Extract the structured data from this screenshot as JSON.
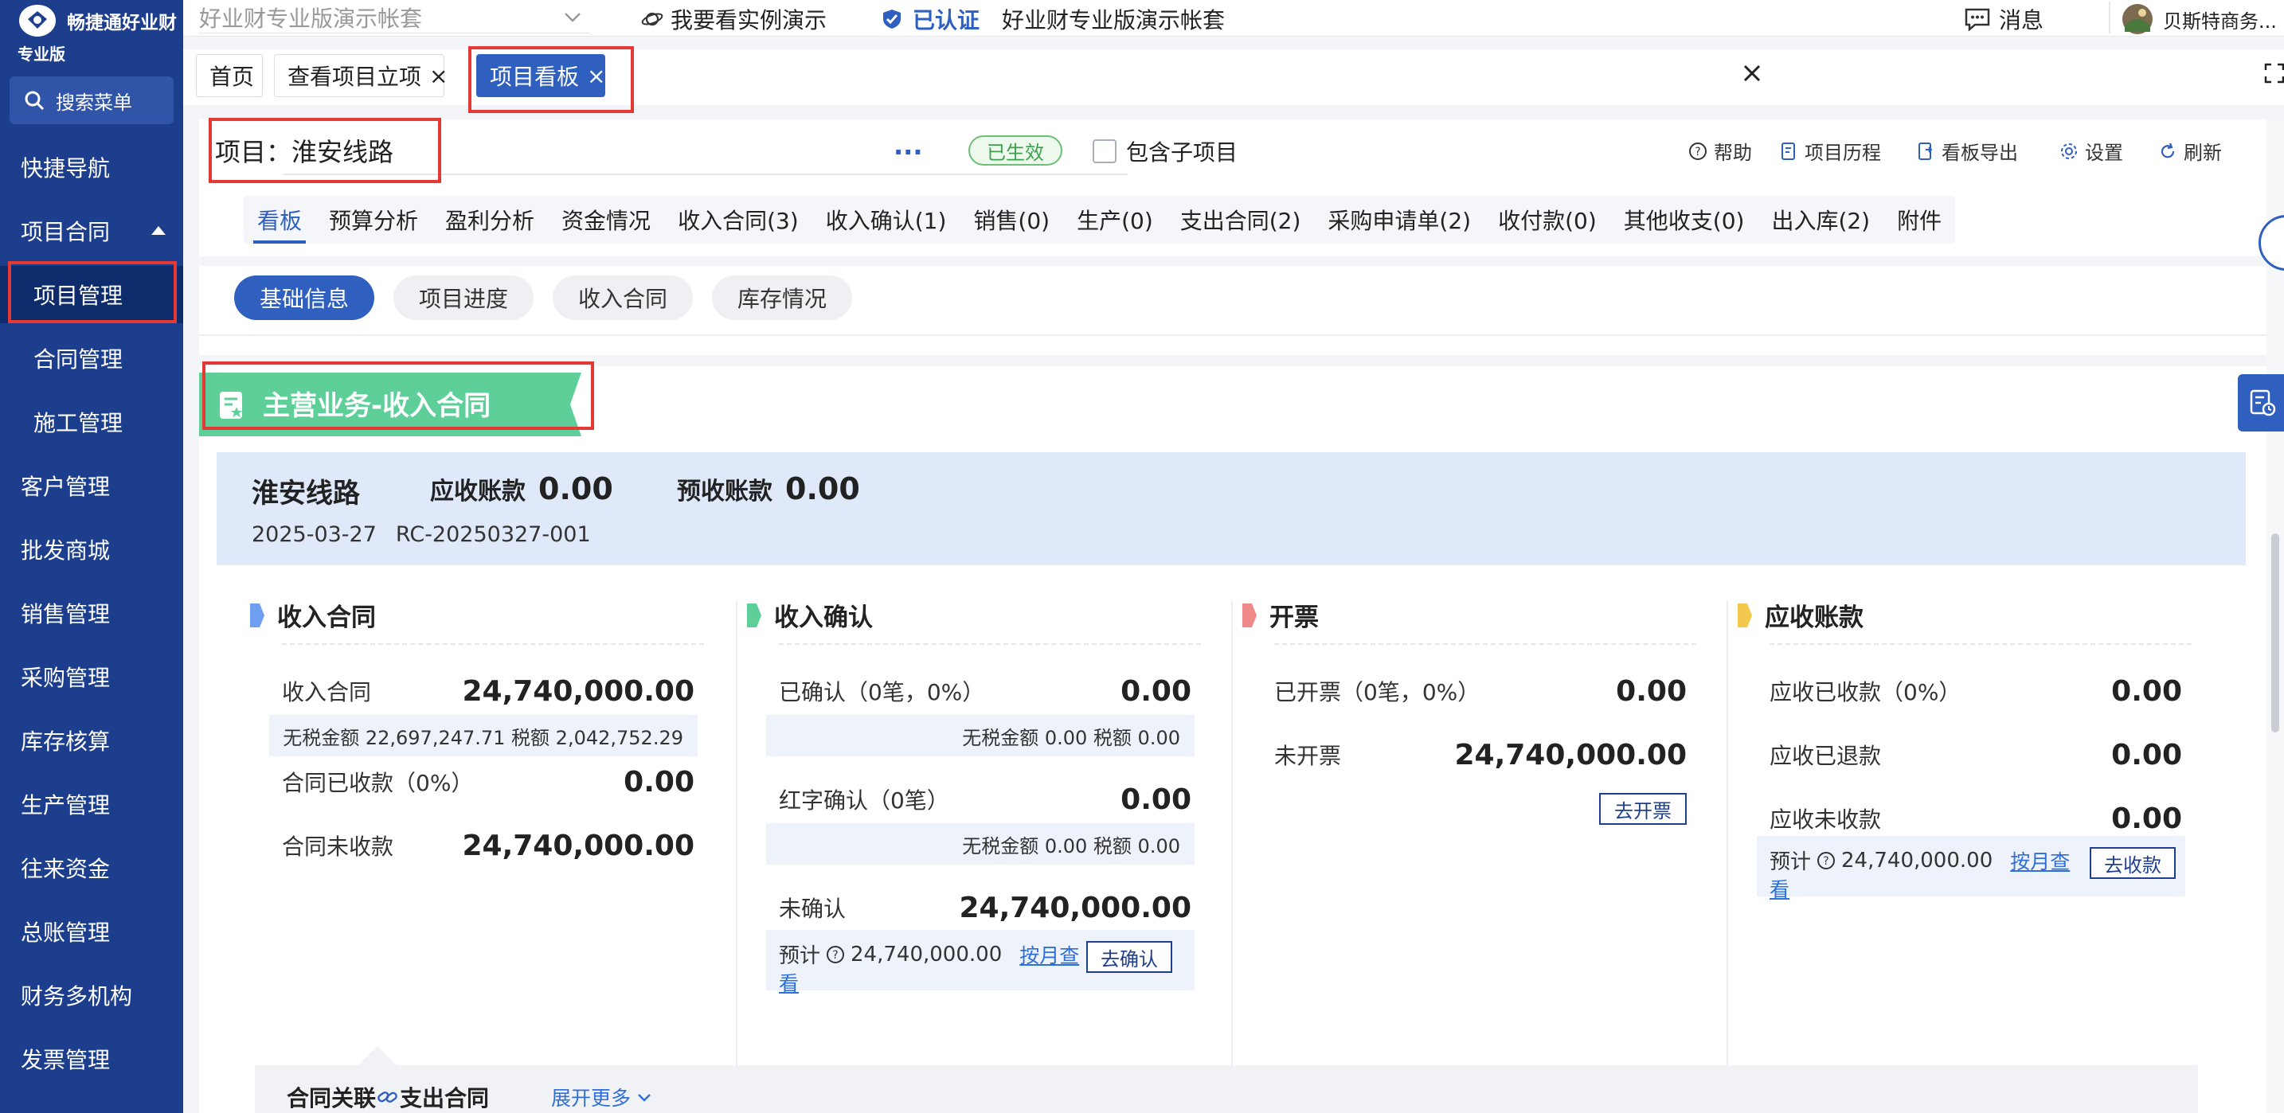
{
  "sidebar": {
    "brand": "畅捷通好业财",
    "edition": "专业版",
    "search_label": "搜索菜单",
    "items": [
      {
        "label": "快捷导航"
      },
      {
        "label": "项目合同"
      },
      {
        "label": "项目管理"
      },
      {
        "label": "合同管理"
      },
      {
        "label": "施工管理"
      },
      {
        "label": "客户管理"
      },
      {
        "label": "批发商城"
      },
      {
        "label": "销售管理"
      },
      {
        "label": "采购管理"
      },
      {
        "label": "库存核算"
      },
      {
        "label": "生产管理"
      },
      {
        "label": "往来资金"
      },
      {
        "label": "总账管理"
      },
      {
        "label": "财务多机构"
      },
      {
        "label": "发票管理"
      }
    ]
  },
  "topbar": {
    "account_select": "好业财专业版演示帐套",
    "demo_link": "我要看实例演示",
    "verified": "已认证",
    "account_name": "好业财专业版演示帐套",
    "messages": "消息",
    "user": "贝斯特商务..."
  },
  "page_tabs": [
    {
      "label": "首页"
    },
    {
      "label": "查看项目立项"
    },
    {
      "label": "项目看板"
    }
  ],
  "project": {
    "label": "项目：",
    "name": "淮安线路",
    "more": "···",
    "status": "已生效",
    "include_sub": "包含子项目"
  },
  "tools": {
    "help": "帮助",
    "history": "项目历程",
    "export": "看板导出",
    "settings": "设置",
    "refresh": "刷新"
  },
  "module_tabs": [
    "看板",
    "预算分析",
    "盈利分析",
    "资金情况",
    "收入合同(3)",
    "收入确认(1)",
    "销售(0)",
    "生产(0)",
    "支出合同(2)",
    "采购申请单(2)",
    "收付款(0)",
    "其他收支(0)",
    "出入库(2)",
    "附件"
  ],
  "sub_tabs": [
    "基础信息",
    "项目进度",
    "收入合同",
    "库存情况"
  ],
  "section_title": "主营业务-收入合同",
  "summary": {
    "name": "淮安线路",
    "receivable_label": "应收账款",
    "receivable_value": "0.00",
    "prepaid_label": "预收账款",
    "prepaid_value": "0.00",
    "date": "2025-03-27",
    "code": "RC-20250327-001"
  },
  "cards": {
    "contract": {
      "title": "收入合同",
      "r1_label": "收入合同",
      "r1_value": "24,740,000.00",
      "r1_sub": "无税金额 22,697,247.71 税额 2,042,752.29",
      "r2_label": "合同已收款（0%）",
      "r2_value": "0.00",
      "r3_label": "合同未收款",
      "r3_value": "24,740,000.00"
    },
    "confirm": {
      "title": "收入确认",
      "r1_label": "已确认（0笔，0%）",
      "r1_value": "0.00",
      "r1_sub": "无税金额 0.00 税额 0.00",
      "r2_label": "红字确认（0笔）",
      "r2_value": "0.00",
      "r2_sub": "无税金额 0.00 税额 0.00",
      "r3_label": "未确认",
      "r3_value": "24,740,000.00",
      "est_label": "预计",
      "est_value": "24,740,000.00",
      "link_a": "按月查",
      "link_b": "看",
      "button": "去确认"
    },
    "invoice": {
      "title": "开票",
      "r1_label": "已开票（0笔，0%）",
      "r1_value": "0.00",
      "r2_label": "未开票",
      "r2_value": "24,740,000.00",
      "button": "去开票"
    },
    "receivable": {
      "title": "应收账款",
      "r1_label": "应收已收款（0%）",
      "r1_value": "0.00",
      "r2_label": "应收已退款",
      "r2_value": "0.00",
      "r3_label": "应收未收款",
      "r3_value": "0.00",
      "est_label": "预计",
      "est_value": "24,740,000.00",
      "link_a": "按月查",
      "link_b": "看",
      "button": "去收款"
    }
  },
  "bottom": {
    "title_a": "合同关联",
    "title_b": "支出合同",
    "expand": "展开更多"
  },
  "colors": {
    "sidebar": "#1c3e8c",
    "accent": "#2f5fbf",
    "banner": "#5fcf9a",
    "flag_contract": "#6f9ef0",
    "flag_confirm": "#5fcf9a",
    "flag_invoice": "#f08a8a",
    "flag_receivable": "#f2c94c",
    "highlight": "#e53935"
  }
}
